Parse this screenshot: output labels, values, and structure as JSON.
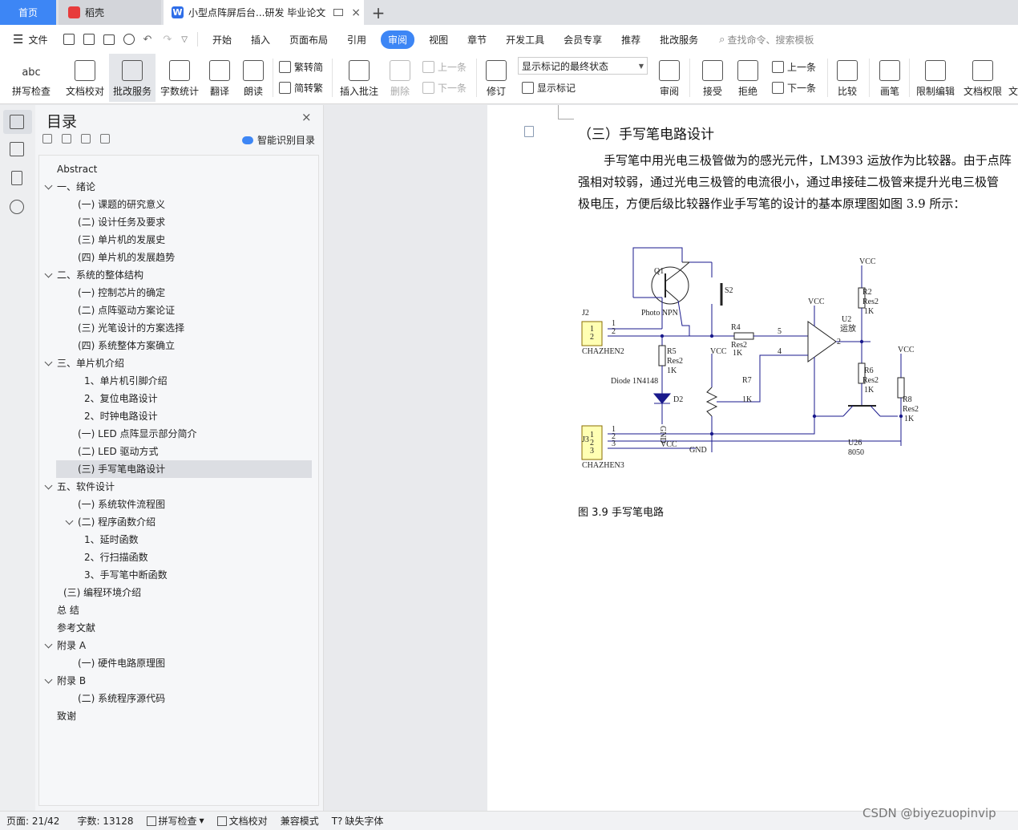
{
  "tabs": {
    "home": "首页",
    "daoke": "稻壳",
    "doc": "小型点阵屏后台...研发 毕业论文",
    "new_tab": "+"
  },
  "menu": {
    "file": "文件",
    "items": [
      "开始",
      "插入",
      "页面布局",
      "引用",
      "审阅",
      "视图",
      "章节",
      "开发工具",
      "会员专享",
      "推荐",
      "批改服务"
    ],
    "active": "审阅",
    "search_placeholder": "查找命令、搜索模板"
  },
  "ribbon": {
    "spell": "拼写检查",
    "doc_check": "文档校对",
    "correct_service": "批改服务",
    "word_count": "字数统计",
    "translate": "翻译",
    "read_aloud": "朗读",
    "trad": "繁转简",
    "simp": "简转繁",
    "insert_comment": "插入批注",
    "delete": "删除",
    "prev": "上一条",
    "next": "下一条",
    "revise": "修订",
    "markup_state": "显示标记的最终状态",
    "show_markup": "显示标记",
    "review": "审阅",
    "accept": "接受",
    "reject": "拒绝",
    "prev2": "上一条",
    "next2": "下一条",
    "compare": "比较",
    "pen": "画笔",
    "restrict": "限制编辑",
    "doc_perm": "文档权限",
    "trunc": "文"
  },
  "nav": {
    "title": "目录",
    "close": "×",
    "ai": "智能识别目录",
    "items": [
      {
        "text": "Abstract",
        "level": 0
      },
      {
        "text": "一、绪论",
        "level": 0,
        "chev": true
      },
      {
        "text": "(一) 课题的研究意义",
        "level": 1
      },
      {
        "text": "(二) 设计任务及要求",
        "level": 1
      },
      {
        "text": "(三) 单片机的发展史",
        "level": 1
      },
      {
        "text": "(四) 单片机的发展趋势",
        "level": 1
      },
      {
        "text": "二、系统的整体结构",
        "level": 0,
        "chev": true
      },
      {
        "text": "(一) 控制芯片的确定",
        "level": 1
      },
      {
        "text": "(二) 点阵驱动方案论证",
        "level": 1
      },
      {
        "text": "(三) 光笔设计的方案选择",
        "level": 1
      },
      {
        "text": "(四) 系统整体方案确立",
        "level": 1
      },
      {
        "text": "三、单片机介绍",
        "level": 0,
        "chev": true
      },
      {
        "text": "1、单片机引脚介绍",
        "level": 2
      },
      {
        "text": "2、复位电路设计",
        "level": 2
      },
      {
        "text": "2、时钟电路设计",
        "level": 2
      },
      {
        "text": "(一)   LED 点阵显示部分简介",
        "level": 1
      },
      {
        "text": "(二) LED 驱动方式",
        "level": 1
      },
      {
        "text": "(三) 手写笔电路设计",
        "level": 1,
        "selected": true
      },
      {
        "text": "五、软件设计",
        "level": 0,
        "chev": true
      },
      {
        "text": "(一) 系统软件流程图",
        "level": 1
      },
      {
        "text": "(二) 程序函数介绍",
        "level": 1,
        "chev": true
      },
      {
        "text": "1、延时函数",
        "level": 2
      },
      {
        "text": "2、行扫描函数",
        "level": 2
      },
      {
        "text": "3、手写笔中断函数",
        "level": 2
      },
      {
        "text": "(三) 编程环境介绍",
        "level": 3
      },
      {
        "text": "总   结",
        "level": 0
      },
      {
        "text": "参考文献",
        "level": 0
      },
      {
        "text": "附录  A",
        "level": 0,
        "chev": true
      },
      {
        "text": "(一) 硬件电路原理图",
        "level": 1
      },
      {
        "text": "附录 B",
        "level": 0,
        "chev": true
      },
      {
        "text": "(二) 系统程序源代码",
        "level": 1
      },
      {
        "text": "致谢",
        "level": 0
      }
    ]
  },
  "document": {
    "section_title": "（三）手写笔电路设计",
    "para1": "手写笔中用光电三极管做为的感光元件，LM393 运放作为比较器。由于点阵",
    "para2": "强相对较弱，通过光电三极管的电流很小，通过串接硅二极管来提升光电三极管",
    "para3": "极电压，方便后级比较器作业手写笔的设计的基本原理图如图 3.9 所示：",
    "caption": "图 3.9 手写笔电路",
    "circuit_labels": {
      "q1": "Q1",
      "s2": "S2",
      "photo": "Photo NPN",
      "j2": "J2",
      "j2_name": "CHAZHEN2",
      "r4": "R4",
      "r4_type": "Res2",
      "r4_val": "1K",
      "r5": "R5",
      "r5_type": "Res2",
      "r5_val": "1K",
      "diode": "Diode 1N4148",
      "d2": "D2",
      "gnd1": "GND",
      "gnd2": "GND",
      "vcc": "VCC",
      "r7": "R7",
      "r7_val": "1K",
      "r2": "R2",
      "r2_type": "Res2",
      "r2_val": "1K",
      "u2": "U2",
      "u2_name": "运放",
      "r6": "R6",
      "r6_type": "Res2",
      "r6_val": "1K",
      "r8": "R8",
      "r8_type": "Res2",
      "r8_val": "1K",
      "u26": "U26",
      "u26_type": "8050",
      "j3": "J3",
      "j3_name": "CHAZHEN3",
      "pin1": "1",
      "pin2": "2",
      "pin3": "3",
      "pin4": "4",
      "pin5": "5"
    }
  },
  "status": {
    "page": "页面: 21/42",
    "words": "字数: 13128",
    "spell": "拼写检查",
    "doc_check": "文档校对",
    "compat": "兼容模式",
    "missing_font": "缺失字体"
  },
  "watermark": "CSDN @biyezuopinvip"
}
